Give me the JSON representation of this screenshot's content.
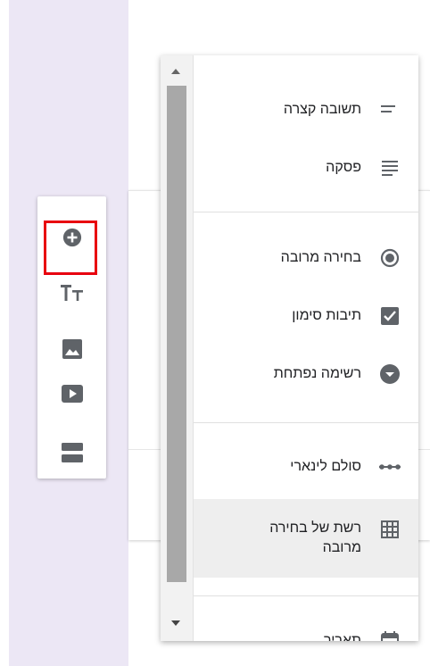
{
  "toolbar": {
    "buttons": [
      {
        "name": "add-question",
        "icon": "plus-circle-icon",
        "selected": true
      },
      {
        "name": "add-title",
        "icon": "title-text-icon"
      },
      {
        "name": "add-image",
        "icon": "image-icon"
      },
      {
        "name": "add-video",
        "icon": "video-icon"
      },
      {
        "name": "add-section",
        "icon": "section-icon"
      }
    ],
    "highlight_color": "#e8000f"
  },
  "question_type_menu": {
    "groups": [
      [
        {
          "label": "תשובה קצרה",
          "icon": "short-answer-icon"
        },
        {
          "label": "פסקה",
          "icon": "paragraph-icon"
        }
      ],
      [
        {
          "label": "בחירה מרובה",
          "icon": "radio-button-icon"
        },
        {
          "label": "תיבות סימון",
          "icon": "checkbox-icon"
        },
        {
          "label": "רשימה נפתחת",
          "icon": "dropdown-icon"
        }
      ],
      [
        {
          "label": "סולם לינארי",
          "icon": "linear-scale-icon"
        },
        {
          "label": "רשת של בחירה מרובה",
          "icon": "grid-icon",
          "hovered": true
        }
      ],
      [
        {
          "label": "תאריך",
          "icon": "calendar-icon"
        }
      ]
    ]
  },
  "colors": {
    "icon": "#5f6368",
    "accent_band": "#ece7f5",
    "text": "#202124"
  }
}
